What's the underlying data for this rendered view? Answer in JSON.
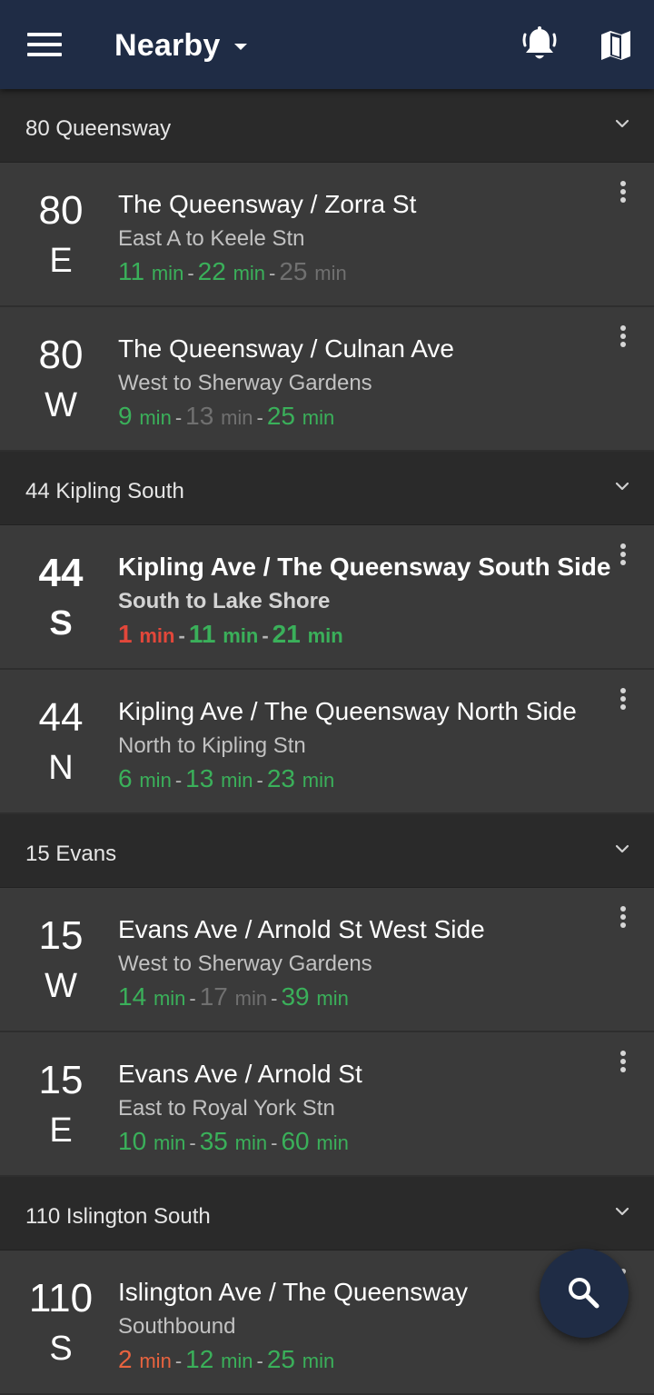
{
  "app_bar": {
    "title": "Nearby",
    "icons": [
      "menu-icon",
      "dropdown-caret-icon",
      "bell-icon",
      "map-icon"
    ]
  },
  "colors": {
    "app_bar": "#1f2c45",
    "background": "#2c2c2c",
    "row": "#3a3a3a",
    "on_time_green": "#3ab05a",
    "scheduled_gray": "#707070",
    "due_red": "#e2473a",
    "due_orange": "#e8633f"
  },
  "groups": [
    {
      "title": "80 Queensway",
      "stops": [
        {
          "route_number": "80",
          "direction": "E",
          "name": "The Queensway / Zorra St",
          "destination": "East A to Keele Stn",
          "bold": false,
          "times": [
            {
              "value": "11",
              "unit": "min",
              "color": "green"
            },
            {
              "value": "22",
              "unit": "min",
              "color": "green"
            },
            {
              "value": "25",
              "unit": "min",
              "color": "gray"
            }
          ]
        },
        {
          "route_number": "80",
          "direction": "W",
          "name": "The Queensway / Culnan Ave",
          "destination": "West to Sherway Gardens",
          "bold": false,
          "times": [
            {
              "value": "9",
              "unit": "min",
              "color": "green"
            },
            {
              "value": "13",
              "unit": "min",
              "color": "gray"
            },
            {
              "value": "25",
              "unit": "min",
              "color": "green"
            }
          ]
        }
      ]
    },
    {
      "title": "44 Kipling South",
      "stops": [
        {
          "route_number": "44",
          "direction": "S",
          "name": "Kipling Ave / The Queensway South Side",
          "destination": "South to Lake Shore",
          "bold": true,
          "times": [
            {
              "value": "1",
              "unit": "min",
              "color": "red"
            },
            {
              "value": "11",
              "unit": "min",
              "color": "green"
            },
            {
              "value": "21",
              "unit": "min",
              "color": "green"
            }
          ]
        },
        {
          "route_number": "44",
          "direction": "N",
          "name": "Kipling Ave / The Queensway North Side",
          "destination": "North to Kipling Stn",
          "bold": false,
          "times": [
            {
              "value": "6",
              "unit": "min",
              "color": "green"
            },
            {
              "value": "13",
              "unit": "min",
              "color": "green"
            },
            {
              "value": "23",
              "unit": "min",
              "color": "green"
            }
          ]
        }
      ]
    },
    {
      "title": "15 Evans",
      "stops": [
        {
          "route_number": "15",
          "direction": "W",
          "name": "Evans Ave / Arnold St West Side",
          "destination": "West to Sherway Gardens",
          "bold": false,
          "times": [
            {
              "value": "14",
              "unit": "min",
              "color": "green"
            },
            {
              "value": "17",
              "unit": "min",
              "color": "gray"
            },
            {
              "value": "39",
              "unit": "min",
              "color": "green"
            }
          ]
        },
        {
          "route_number": "15",
          "direction": "E",
          "name": "Evans Ave / Arnold St",
          "destination": "East to Royal York Stn",
          "bold": false,
          "times": [
            {
              "value": "10",
              "unit": "min",
              "color": "green"
            },
            {
              "value": "35",
              "unit": "min",
              "color": "green"
            },
            {
              "value": "60",
              "unit": "min",
              "color": "green"
            }
          ]
        }
      ]
    },
    {
      "title": "110 Islington South",
      "stops": [
        {
          "route_number": "110",
          "direction": "S",
          "name": "Islington Ave / The Queensway",
          "destination": "Southbound",
          "bold": false,
          "times": [
            {
              "value": "2",
              "unit": "min",
              "color": "orange"
            },
            {
              "value": "12",
              "unit": "min",
              "color": "green"
            },
            {
              "value": "25",
              "unit": "min",
              "color": "green"
            }
          ]
        }
      ]
    }
  ],
  "fab": {
    "icon": "search-icon"
  }
}
